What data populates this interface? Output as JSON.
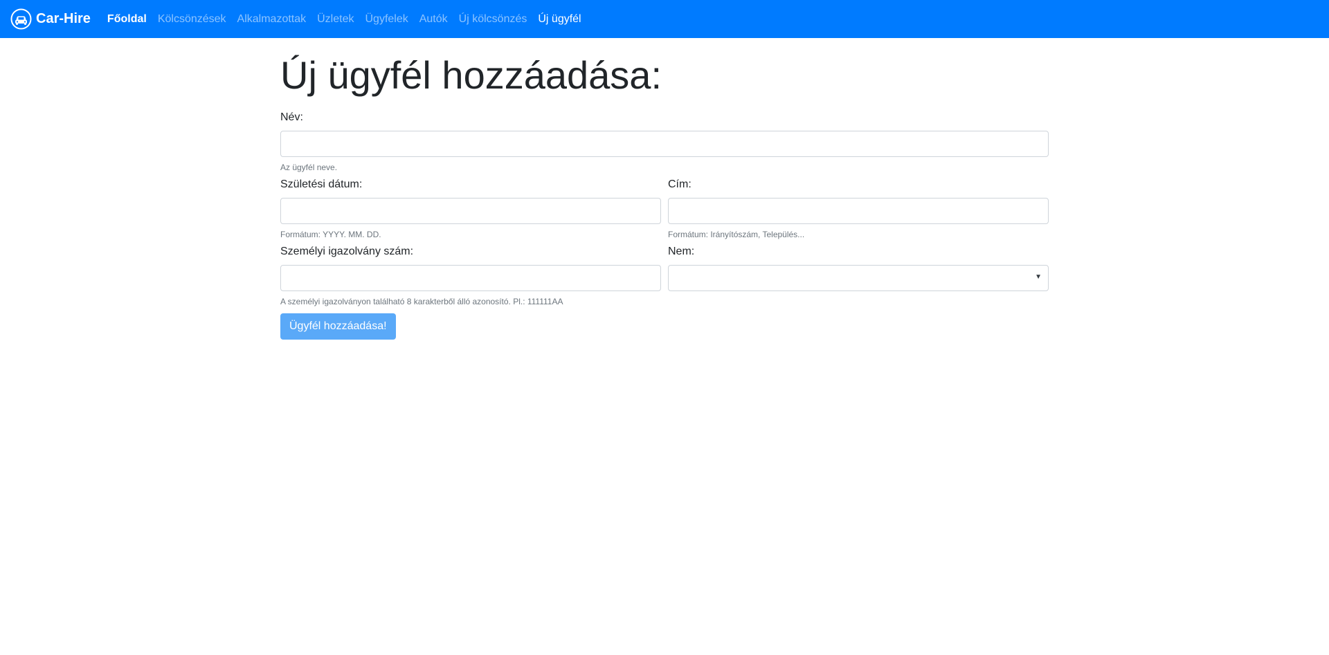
{
  "navbar": {
    "brand": "Car-Hire",
    "brand_icon": "car-circle-icon",
    "links": [
      {
        "label": "Főoldal"
      },
      {
        "label": "Kölcsönzések"
      },
      {
        "label": "Alkalmazottak"
      },
      {
        "label": "Üzletek"
      },
      {
        "label": "Ügyfelek"
      },
      {
        "label": "Autók"
      },
      {
        "label": "Új kölcsönzés"
      },
      {
        "label": "Új ügyfél"
      }
    ],
    "colors": {
      "background": "#007bff",
      "link": "rgba(255,255,255,0.55)",
      "active": "#ffffff"
    }
  },
  "page": {
    "title": "Új ügyfél hozzáadása:"
  },
  "form": {
    "name": {
      "label": "Név:",
      "value": "",
      "help": "Az ügyfél neve."
    },
    "birth_date": {
      "label": "Születési dátum:",
      "value": "",
      "help": "Formátum: YYYY. MM. DD."
    },
    "address": {
      "label": "Cím:",
      "value": "",
      "help": "Formátum: Irányítószám, Település..."
    },
    "id_number": {
      "label": "Személyi igazolvány szám:",
      "value": "",
      "help": "A személyi igazolványon található 8 karakterből álló azonosító. Pl.: 111111AA"
    },
    "gender": {
      "label": "Nem:",
      "value": ""
    },
    "submit_label": "Ügyfél hozzáadása!",
    "colors": {
      "button": "#5aa9f8",
      "help_text": "#6c757d",
      "border": "#ced4da"
    }
  }
}
